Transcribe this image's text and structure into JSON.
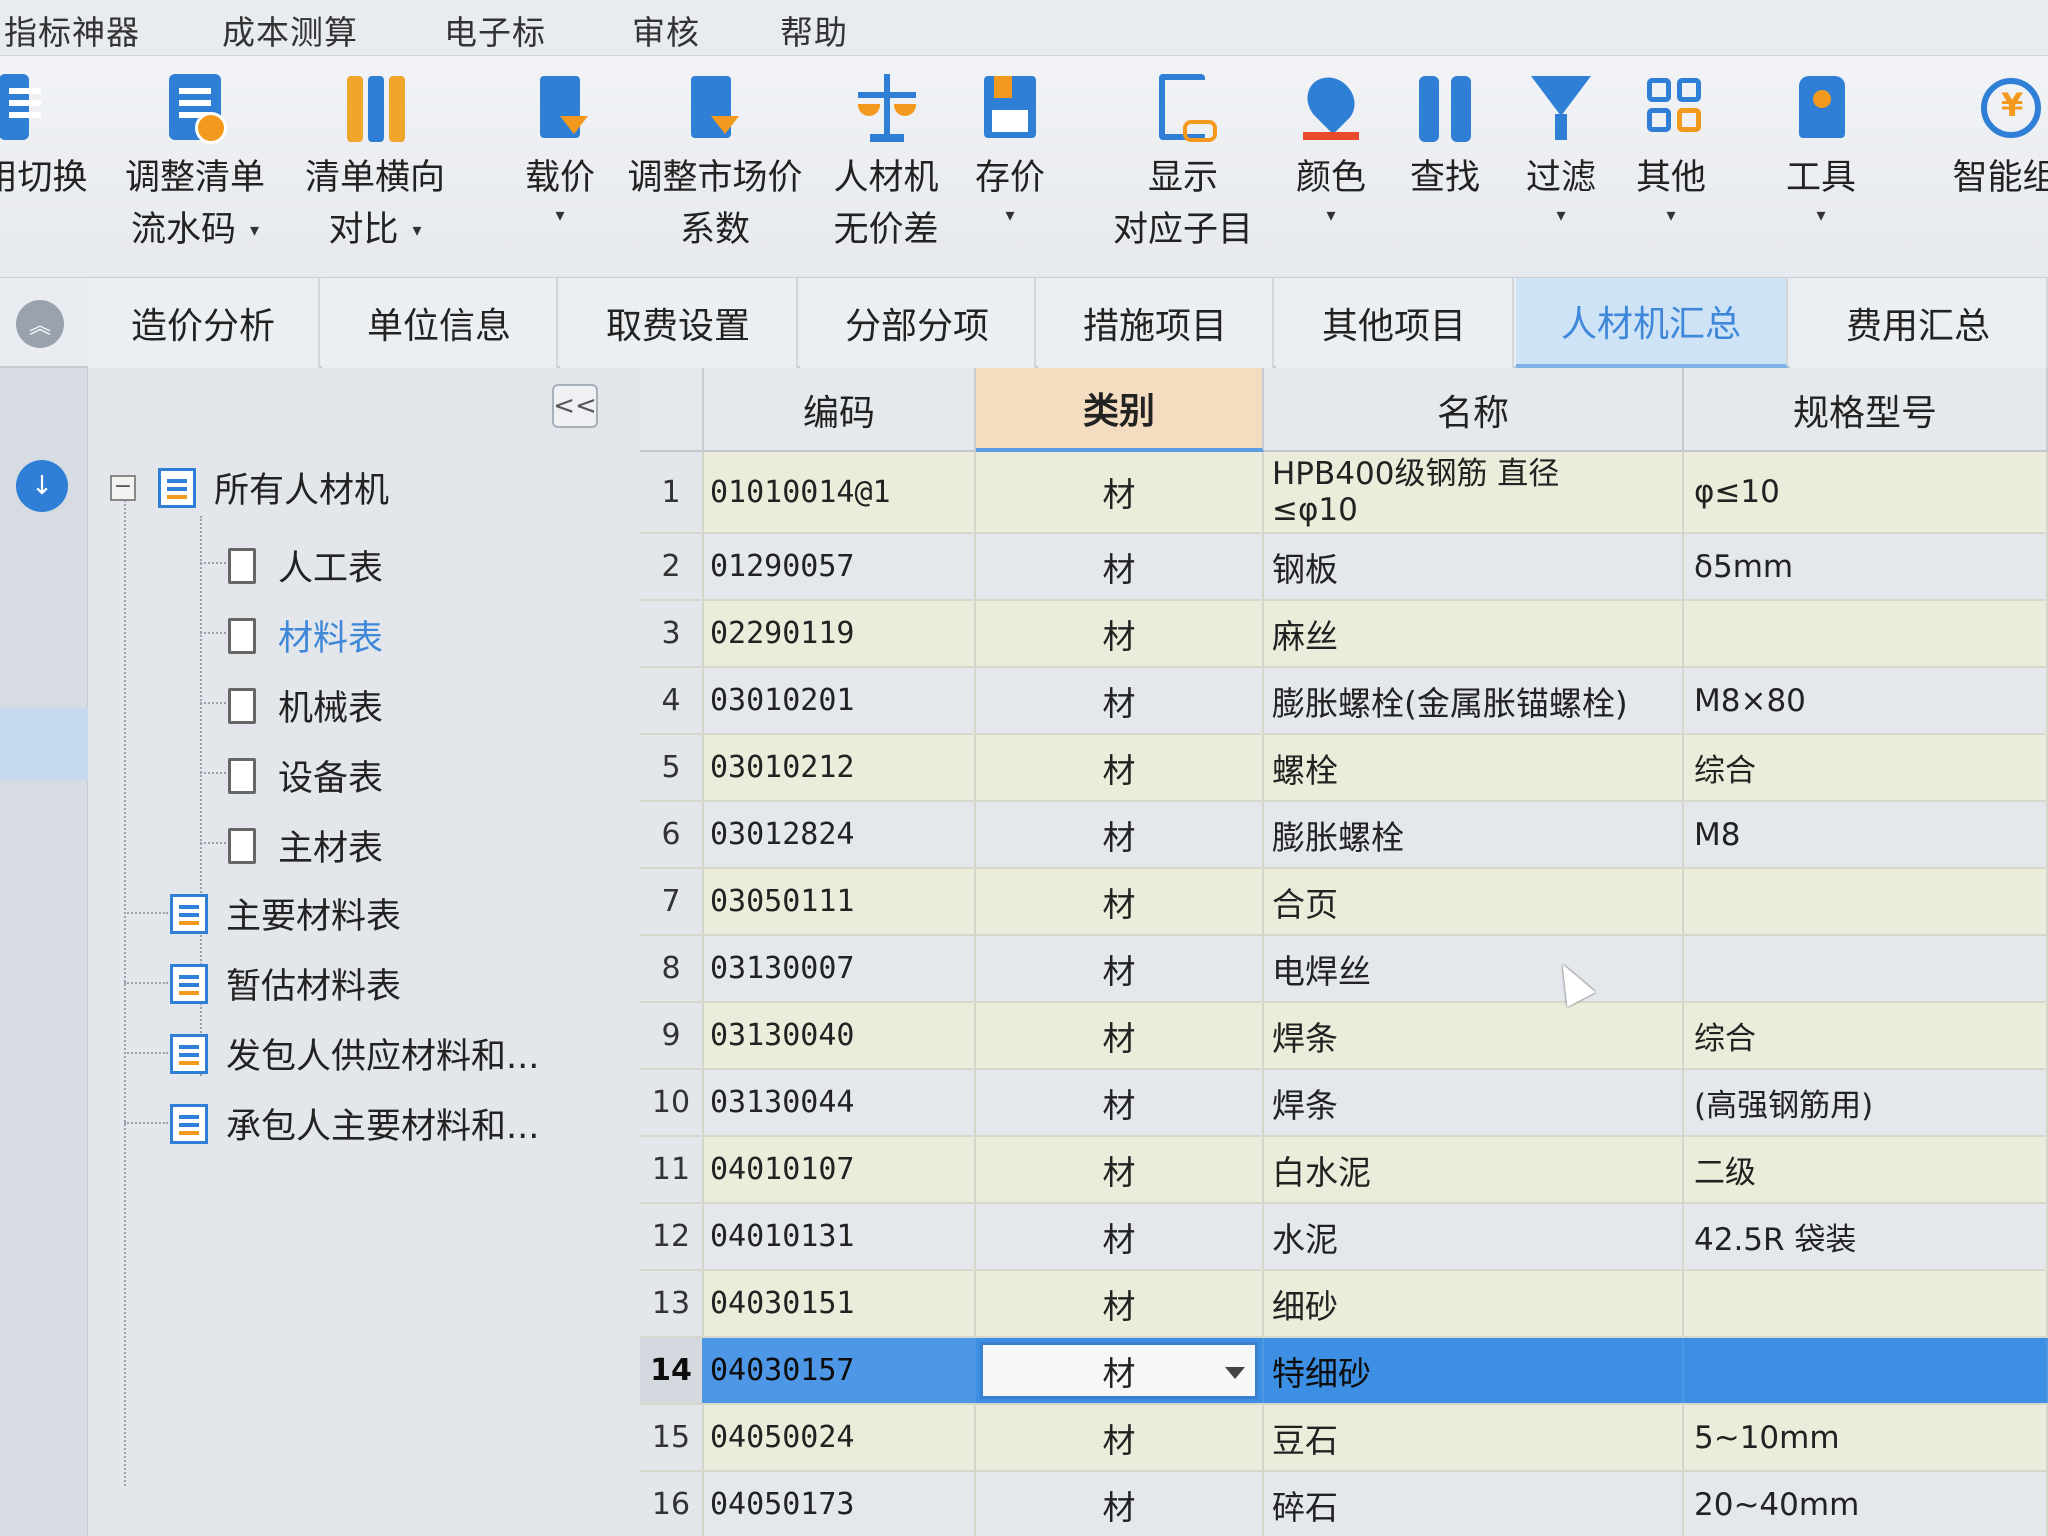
{
  "menu": {
    "items": [
      "指标神器",
      "成本测算",
      "电子标",
      "审核",
      "帮助"
    ]
  },
  "ribbon": {
    "buttons": [
      {
        "line1": "用切换",
        "line2": "",
        "has_dropdown": false,
        "icon": "switch-icon"
      },
      {
        "line1": "调整清单",
        "line2": "流水码",
        "has_dropdown": true,
        "icon": "renumber-icon"
      },
      {
        "line1": "清单横向",
        "line2": "对比",
        "has_dropdown": true,
        "icon": "compare-icon"
      },
      {
        "line1": "载价",
        "line2": "",
        "has_dropdown": true,
        "icon": "load-price-icon"
      },
      {
        "line1": "调整市场价",
        "line2": "系数",
        "has_dropdown": false,
        "icon": "market-price-icon"
      },
      {
        "line1": "人材机",
        "line2": "无价差",
        "has_dropdown": false,
        "icon": "scale-icon"
      },
      {
        "line1": "存价",
        "line2": "",
        "has_dropdown": true,
        "icon": "save-price-icon"
      },
      {
        "line1": "显示",
        "line2": "对应子目",
        "has_dropdown": false,
        "icon": "show-sub-item-icon"
      },
      {
        "line1": "颜色",
        "line2": "",
        "has_dropdown": true,
        "icon": "color-icon"
      },
      {
        "line1": "查找",
        "line2": "",
        "has_dropdown": false,
        "icon": "find-icon"
      },
      {
        "line1": "过滤",
        "line2": "",
        "has_dropdown": true,
        "icon": "filter-icon"
      },
      {
        "line1": "其他",
        "line2": "",
        "has_dropdown": true,
        "icon": "other-icon"
      },
      {
        "line1": "工具",
        "line2": "",
        "has_dropdown": true,
        "icon": "tools-icon"
      },
      {
        "line1": "智能组",
        "line2": "",
        "has_dropdown": false,
        "icon": "smart-group-icon"
      }
    ]
  },
  "tabs": {
    "items": [
      "造价分析",
      "单位信息",
      "取费设置",
      "分部分项",
      "措施项目",
      "其他项目",
      "人材机汇总",
      "费用汇总"
    ],
    "active_index": 6
  },
  "tree": {
    "collapse_label": "<<",
    "root": "所有人材机",
    "children": [
      "人工表",
      "材料表",
      "机械表",
      "设备表",
      "主材表"
    ],
    "selected_child": "材料表",
    "other_nodes": [
      "主要材料表",
      "暂估材料表",
      "发包人供应材料和...",
      "承包人主要材料和..."
    ]
  },
  "grid": {
    "headers": {
      "code": "编码",
      "category": "类别",
      "name": "名称",
      "spec": "规格型号"
    },
    "sorted_column": "category",
    "selected_row": 14,
    "rows": [
      {
        "no": "1",
        "code": "01010014@1",
        "category": "材",
        "name": "HPB400级钢筋 直径",
        "name2": "≤φ10",
        "spec": "φ≤10"
      },
      {
        "no": "2",
        "code": "01290057",
        "category": "材",
        "name": "钢板",
        "spec": "δ5mm"
      },
      {
        "no": "3",
        "code": "02290119",
        "category": "材",
        "name": "麻丝",
        "spec": ""
      },
      {
        "no": "4",
        "code": "03010201",
        "category": "材",
        "name": "膨胀螺栓(金属胀锚螺栓)",
        "spec": "M8×80"
      },
      {
        "no": "5",
        "code": "03010212",
        "category": "材",
        "name": "螺栓",
        "spec": "综合"
      },
      {
        "no": "6",
        "code": "03012824",
        "category": "材",
        "name": "膨胀螺栓",
        "spec": "M8"
      },
      {
        "no": "7",
        "code": "03050111",
        "category": "材",
        "name": "合页",
        "spec": ""
      },
      {
        "no": "8",
        "code": "03130007",
        "category": "材",
        "name": "电焊丝",
        "spec": ""
      },
      {
        "no": "9",
        "code": "03130040",
        "category": "材",
        "name": "焊条",
        "spec": "综合"
      },
      {
        "no": "10",
        "code": "03130044",
        "category": "材",
        "name": "焊条",
        "spec": "(高强钢筋用)"
      },
      {
        "no": "11",
        "code": "04010107",
        "category": "材",
        "name": "白水泥",
        "spec": "二级"
      },
      {
        "no": "12",
        "code": "04010131",
        "category": "材",
        "name": "水泥",
        "spec": "42.5R 袋装"
      },
      {
        "no": "13",
        "code": "04030151",
        "category": "材",
        "name": "细砂",
        "spec": ""
      },
      {
        "no": "14",
        "code": "04030157",
        "category": "材",
        "name": "特细砂",
        "spec": ""
      },
      {
        "no": "15",
        "code": "04050024",
        "category": "材",
        "name": "豆石",
        "spec": "5~10mm"
      },
      {
        "no": "16",
        "code": "04050173",
        "category": "材",
        "name": "碎石",
        "spec": "20~40mm"
      }
    ]
  }
}
